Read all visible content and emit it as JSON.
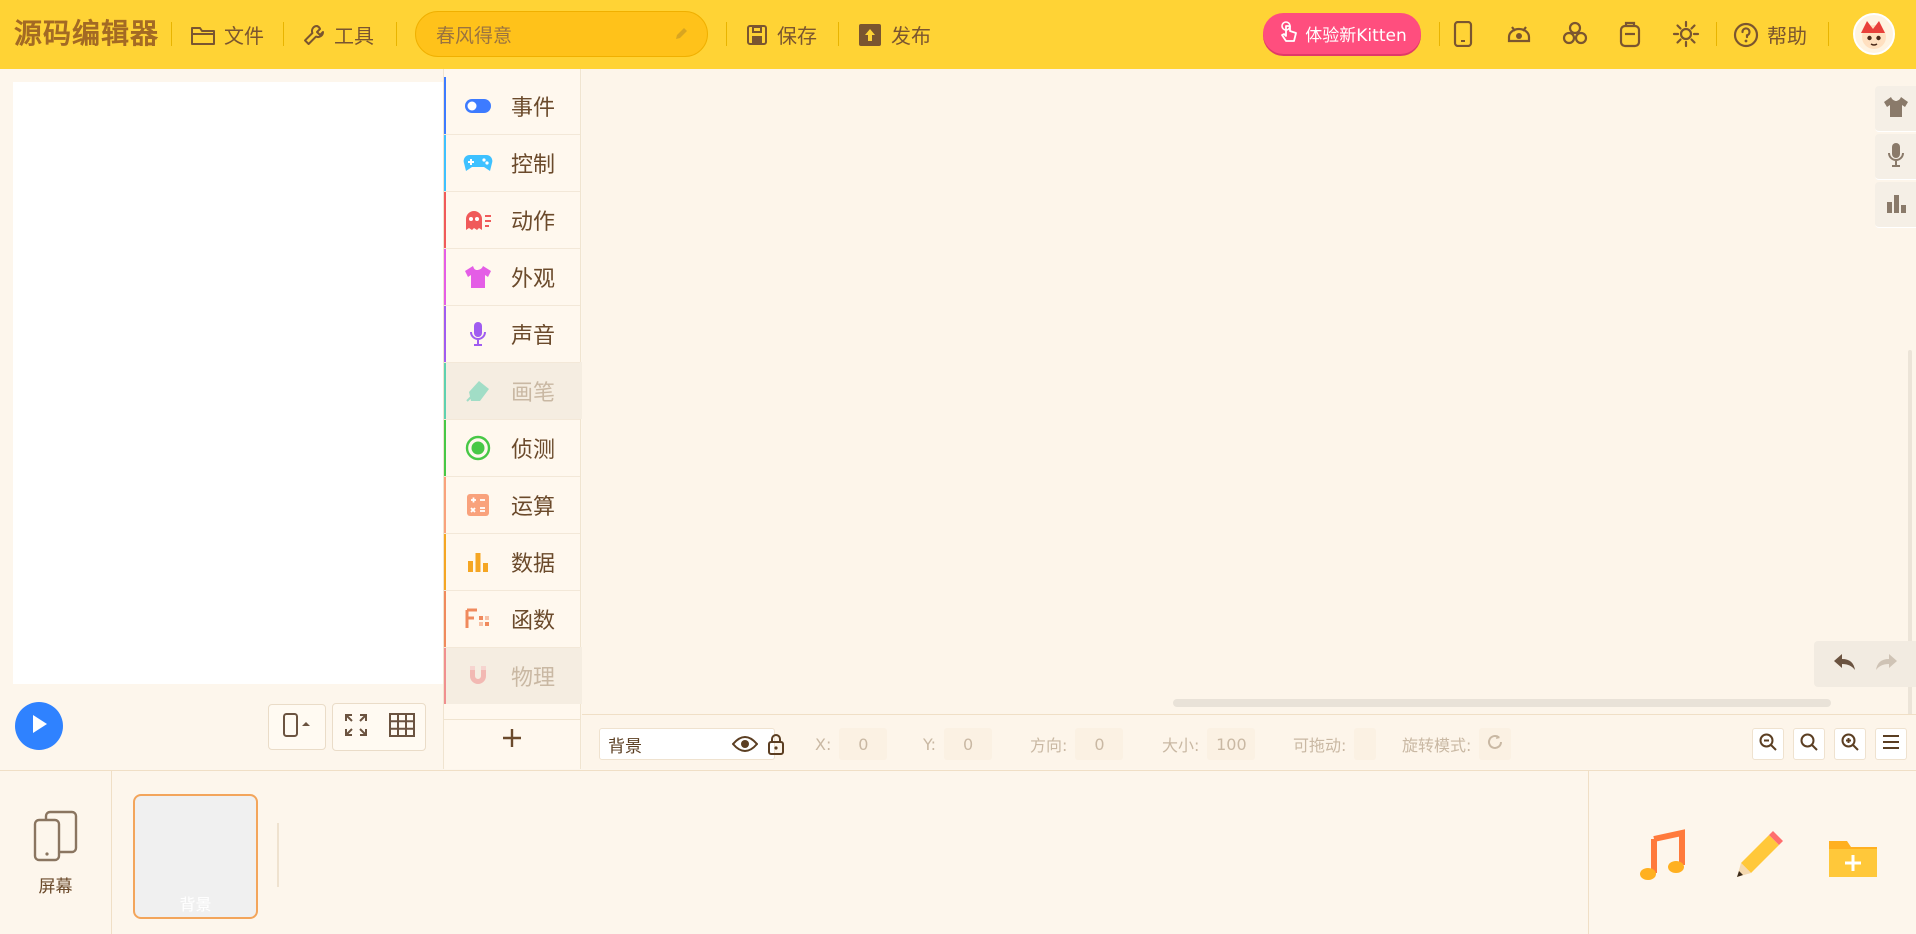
{
  "app": {
    "logo_text": "源码编辑器"
  },
  "toolbar": {
    "file_label": "文件",
    "tools_label": "工具",
    "project_name": "春风得意",
    "save_label": "保存",
    "publish_label": "发布",
    "try_kitten_label": "体验新Kitten",
    "help_label": "帮助",
    "accent_color": "#ffd335",
    "kitten_color": "#ff4e7e"
  },
  "categories": [
    {
      "label": "事件",
      "icon": "toggle-icon",
      "color": "#3d7bff",
      "enabled": true
    },
    {
      "label": "控制",
      "icon": "gamepad-icon",
      "color": "#3ec1ff",
      "enabled": true
    },
    {
      "label": "动作",
      "icon": "ghost-icon",
      "color": "#f05a5a",
      "enabled": true
    },
    {
      "label": "外观",
      "icon": "shirt-icon",
      "color": "#e45de6",
      "enabled": true
    },
    {
      "label": "声音",
      "icon": "microphone-icon",
      "color": "#a05cf0",
      "enabled": true
    },
    {
      "label": "画笔",
      "icon": "pen-icon",
      "color": "#5ed1b0",
      "enabled": false
    },
    {
      "label": "侦测",
      "icon": "radar-icon",
      "color": "#47c846",
      "enabled": true
    },
    {
      "label": "运算",
      "icon": "calculator-icon",
      "color": "#f9a27c",
      "enabled": true
    },
    {
      "label": "数据",
      "icon": "bar-chart-icon",
      "color": "#f5a623",
      "enabled": true
    },
    {
      "label": "函数",
      "icon": "function-icon",
      "color": "#f08a5d",
      "enabled": true
    },
    {
      "label": "物理",
      "icon": "magnet-icon",
      "color": "#f08f8f",
      "enabled": false
    }
  ],
  "properties": {
    "sprite_name": "背景",
    "x_label": "X:",
    "x_value": "0",
    "y_label": "Y:",
    "y_value": "0",
    "direction_label": "方向:",
    "direction_value": "0",
    "size_label": "大小:",
    "size_value": "100",
    "draggable_label": "可拖动:",
    "rotation_label": "旋转模式:"
  },
  "bottom": {
    "screen_label": "屏幕",
    "background_label": "背景"
  }
}
